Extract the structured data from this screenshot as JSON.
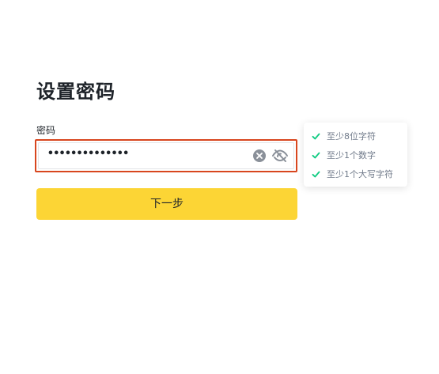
{
  "page": {
    "title": "设置密码"
  },
  "password_field": {
    "label": "密码",
    "value": "••••••••••••••",
    "clear_icon": "clear-circle-icon",
    "visibility_icon": "eye-off-icon"
  },
  "next_button": {
    "label": "下一步"
  },
  "requirements": {
    "items": [
      {
        "text": "至少8位字符",
        "met": true
      },
      {
        "text": "至少1个数字",
        "met": true
      },
      {
        "text": "至少1个大写字符",
        "met": true
      }
    ]
  },
  "colors": {
    "accent": "#fcd535",
    "error_border": "#d8461e",
    "check": "#0ecb81",
    "text_primary": "#1e2329",
    "text_secondary": "#707a8a"
  }
}
